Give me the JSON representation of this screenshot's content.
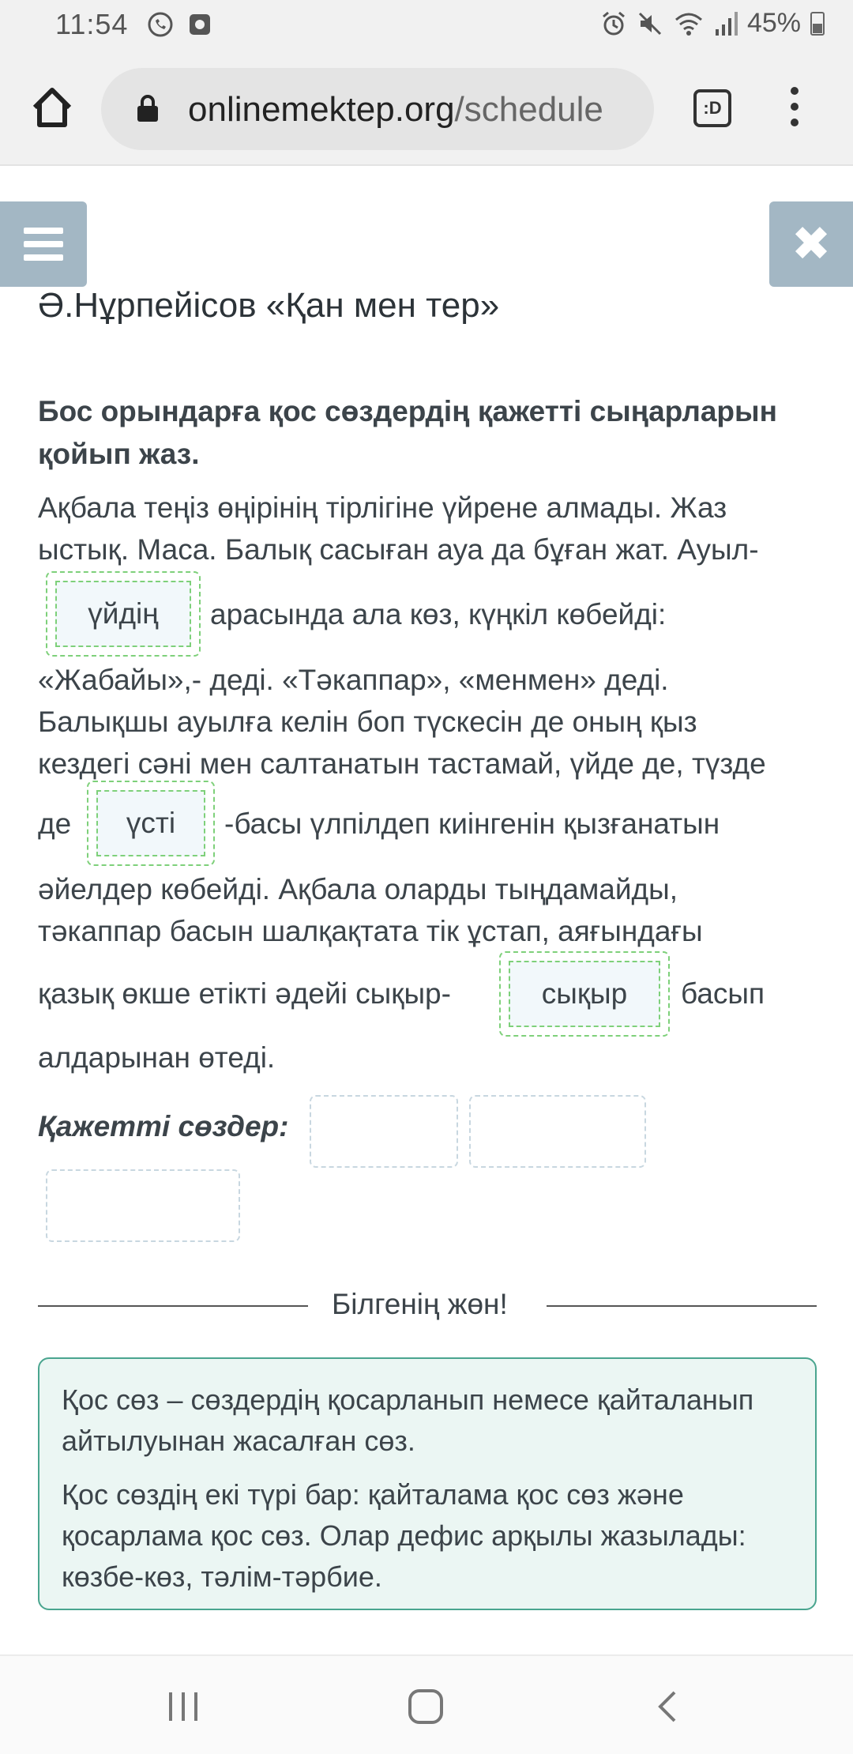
{
  "status_bar": {
    "time": "11:54",
    "battery": "45%",
    "left_icons": [
      "whatsapp-icon",
      "app-notification-icon"
    ],
    "right_icons": [
      "alarm-icon",
      "mute-icon",
      "wifi-icon",
      "signal-icon",
      "battery-icon"
    ]
  },
  "browser": {
    "url_domain": "onlinemektep.org",
    "url_path": "/schedule",
    "tab_label": ":D"
  },
  "lesson": {
    "title": "Ә.Нұрпейісов «Қан мен тер»"
  },
  "task": {
    "instruction": "Бос орындарға қос сөздердің қажетті сыңарларын қойып жаз.",
    "text": {
      "line1": "Ақбала теңіз өңірінің тірлігіне үйрене алмады. Жаз",
      "line2": "ыстық. Маса. Балық сасыған ауа да бұған жат. Ауыл-",
      "line3_after": "арасында ала көз, күңкіл көбейді:",
      "line4": "«Жабайы»,- деді. «Тәкаппар», «менмен» деді.",
      "line5": "Балықшы ауылға келін боп түскесін де оның қыз",
      "line6": "кездегі сәні мен салтанатын тастамай, үйде де, түзде",
      "line7_before": "де",
      "line7_after": "-басы үлпілдеп киінгенін қызғанатын",
      "line8": "әйелдер көбейді. Ақбала оларды тыңдамайды,",
      "line9": "тәкаппар басын шалқақтата тік ұстап, аяғындағы",
      "line10_before": "қазық өкше етікті әдейі сықыр-",
      "line10_after": "басып",
      "line11": "алдарынан өтеді."
    },
    "answers": {
      "slot1": "үйдің",
      "slot2": "үсті",
      "slot3": "сықыр"
    },
    "words_label": "Қажетті сөздер:"
  },
  "info": {
    "divider_label": "Білгенің жөн!",
    "paragraph1": "Қос сөз – сөздердің қосарланып немесе қайталанып айтылуынан жасалған сөз.",
    "paragraph2": "Қос сөздің екі түрі бар: қайталама қос сөз және қосарлама қос сөз. Олар дефис арқылы жазылады: көзбе-көз, тәлім-тәрбие."
  },
  "colors": {
    "side_button": "#a3b7c4",
    "slot_border": "#7ed07a",
    "info_border": "#4aa58f",
    "info_bg": "#ebf6f3"
  }
}
